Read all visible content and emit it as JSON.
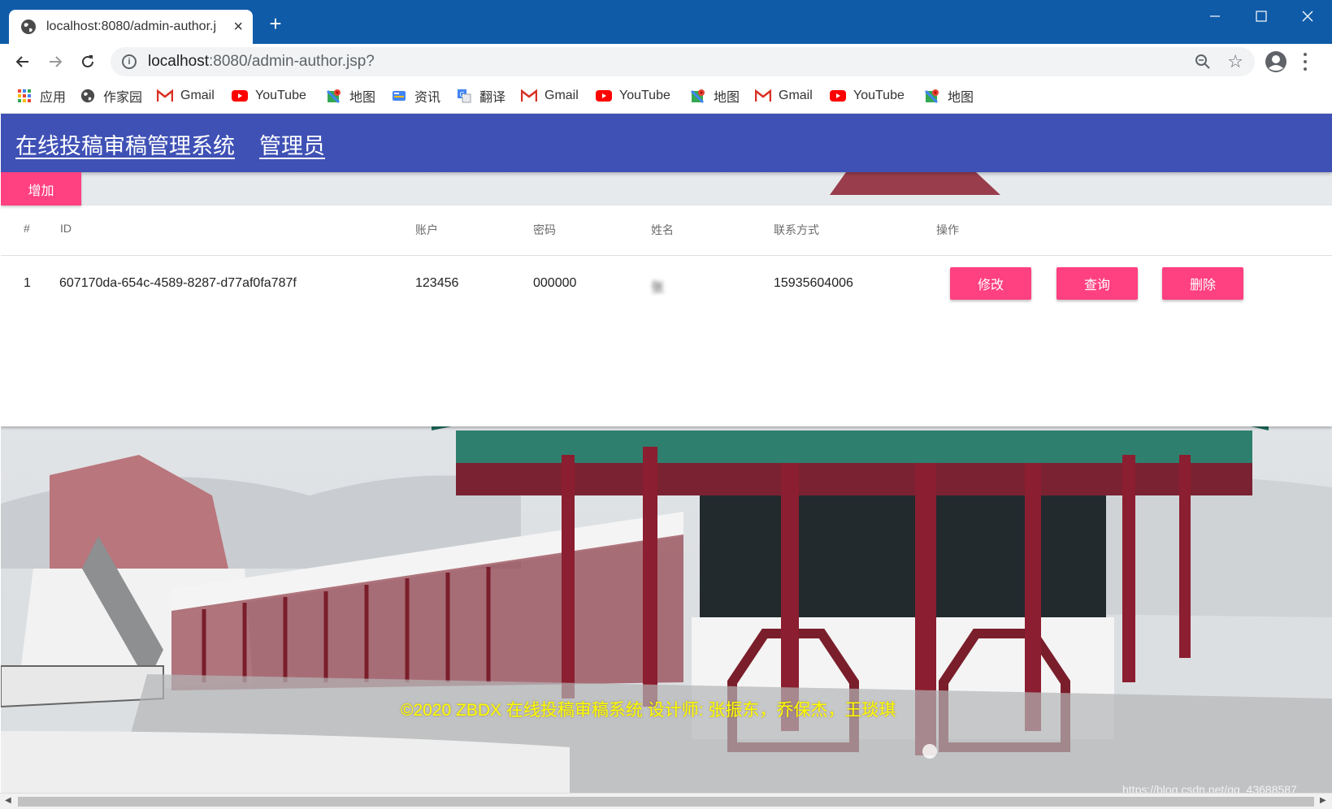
{
  "browser": {
    "tab_title": "localhost:8080/admin-author.j",
    "tab_close": "×",
    "new_tab": "+",
    "url_host": "localhost",
    "url_rest": ":8080/admin-author.jsp?",
    "window_controls": {
      "minimize": "—",
      "maximize": "☐",
      "close": "✕"
    },
    "bookmarks": [
      {
        "label": "应用",
        "icon": "apps-grid-icon"
      },
      {
        "label": "作家园",
        "icon": "globe-icon"
      },
      {
        "label": "Gmail",
        "icon": "gmail-icon"
      },
      {
        "label": "YouTube",
        "icon": "youtube-icon"
      },
      {
        "label": "地图",
        "icon": "maps-icon"
      },
      {
        "label": "资讯",
        "icon": "news-icon"
      },
      {
        "label": "翻译",
        "icon": "translate-icon"
      },
      {
        "label": "Gmail",
        "icon": "gmail-icon"
      },
      {
        "label": "YouTube",
        "icon": "youtube-icon"
      },
      {
        "label": "地图",
        "icon": "maps-icon"
      },
      {
        "label": "Gmail",
        "icon": "gmail-icon"
      },
      {
        "label": "YouTube",
        "icon": "youtube-icon"
      },
      {
        "label": "地图",
        "icon": "maps-icon"
      }
    ]
  },
  "app": {
    "system_title": "在线投稿审稿管理系统",
    "role": "管理员",
    "add_button": "增加",
    "columns": [
      "#",
      "ID",
      "账户",
      "密码",
      "姓名",
      "联系方式",
      "操作"
    ],
    "rows": [
      {
        "index": "1",
        "id": "607170da-654c-4589-8287-d77af0fa787f",
        "account": "123456",
        "password": "000000",
        "name": "张",
        "contact": "15935604006",
        "actions": [
          "修改",
          "查询",
          "删除"
        ]
      }
    ],
    "footer": "©2020 ZBDX 在线投稿审稿系统 设计师: 张振东，乔保杰，王琰琪",
    "watermark": "https://blog.csdn.net/qq_43688587"
  },
  "colors": {
    "titlebar": "#0f5ba8",
    "appbar": "#3f51b5",
    "accent": "#ff4081",
    "footer_text": "#ffff00"
  }
}
